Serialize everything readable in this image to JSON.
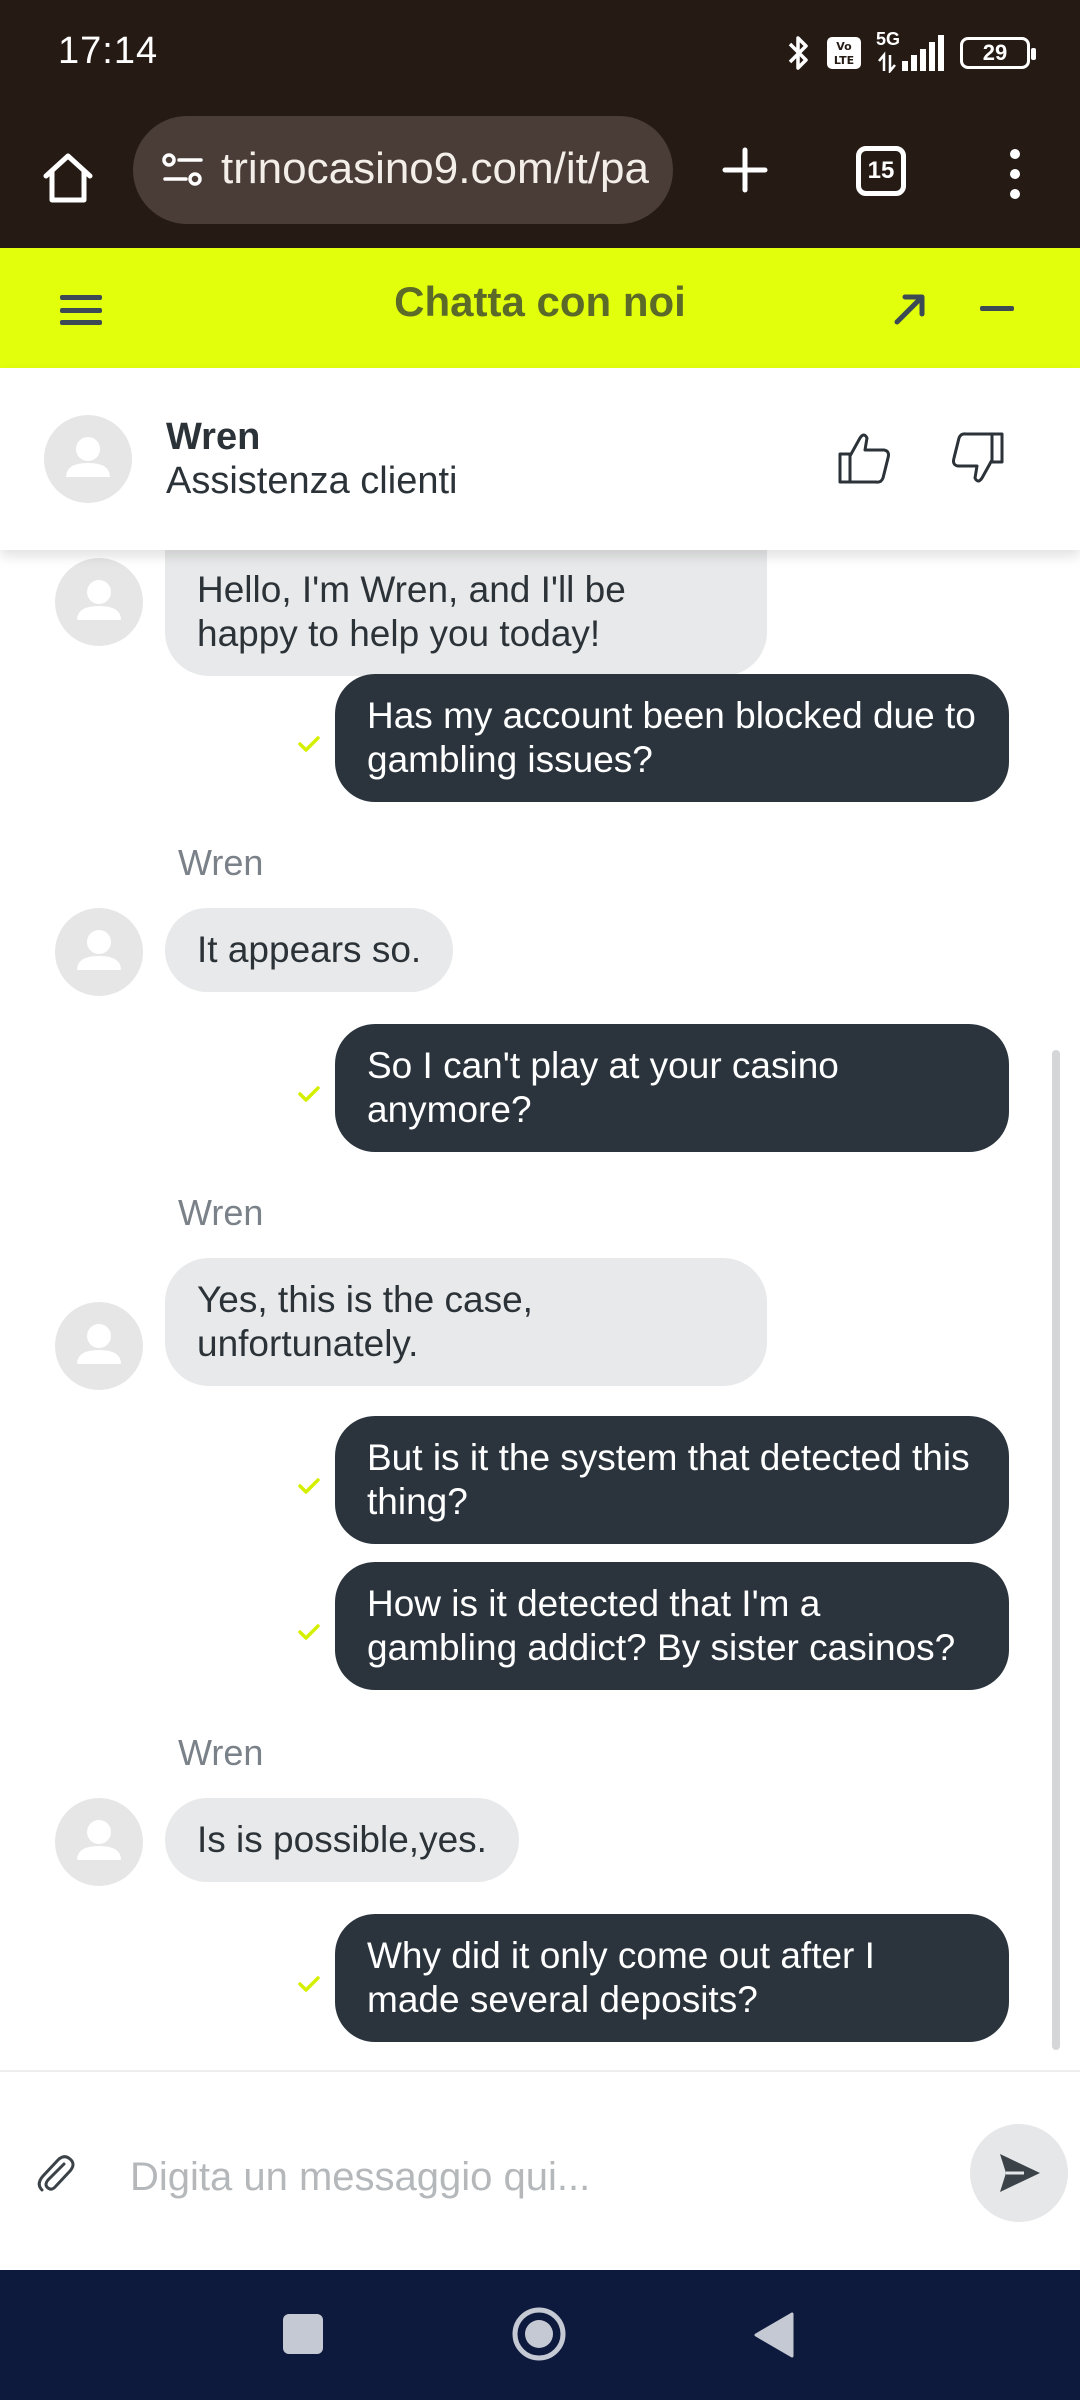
{
  "status_bar": {
    "time": "17:14",
    "network": "5G",
    "battery": "29",
    "icons": [
      "bluetooth-icon",
      "volte-icon",
      "signal-icon",
      "battery-icon"
    ]
  },
  "browser": {
    "url": "trinocasino9.com/it/pa",
    "tab_count": "15"
  },
  "chat": {
    "title": "Chatta con noi",
    "accent_color": "#e2ff0c",
    "agent": {
      "name": "Wren",
      "role": "Assistenza clienti"
    },
    "messages": [
      {
        "from": "agent",
        "text": "Hello, I'm Wren, and I'll be happy to help you today!"
      },
      {
        "from": "user",
        "text": "Has my account been blocked due to gambling issues?"
      },
      {
        "from": "agent",
        "sender": "Wren",
        "text": "It appears so."
      },
      {
        "from": "user",
        "text": "So I can't play at your casino anymore?"
      },
      {
        "from": "agent",
        "sender": "Wren",
        "text": "Yes, this is the case, unfortunately."
      },
      {
        "from": "user",
        "text": "But is it the system that detected this thing?"
      },
      {
        "from": "user",
        "text": "How is it detected that I'm a gambling addict? By sister casinos?"
      },
      {
        "from": "agent",
        "sender": "Wren",
        "text": "Is is possible,yes."
      },
      {
        "from": "user",
        "text": "Why did it only come out after I made several deposits?"
      }
    ],
    "input_placeholder": "Digita un messaggio qui..."
  }
}
